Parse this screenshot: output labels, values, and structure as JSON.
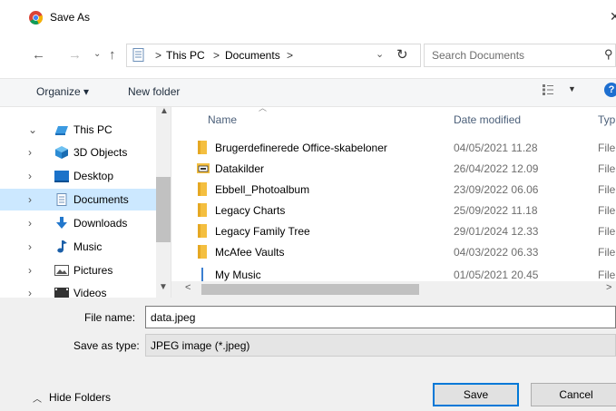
{
  "window": {
    "title": "Save As",
    "close_glyph": "✕"
  },
  "address": {
    "segments": [
      "This PC",
      "Documents"
    ],
    "separator": ">",
    "search_placeholder": "Search Documents"
  },
  "toolbar": {
    "organize": "Organize ▾",
    "new_folder": "New folder"
  },
  "nav": {
    "items": [
      {
        "label": "This PC",
        "icon": "pc-icon",
        "chevron": "⌄",
        "selected": false
      },
      {
        "label": "3D Objects",
        "icon": "cube-icon",
        "chevron": "›",
        "selected": false
      },
      {
        "label": "Desktop",
        "icon": "desktop-icon",
        "chevron": "›",
        "selected": false
      },
      {
        "label": "Documents",
        "icon": "documents-icon",
        "chevron": "›",
        "selected": true
      },
      {
        "label": "Downloads",
        "icon": "download-icon",
        "chevron": "›",
        "selected": false
      },
      {
        "label": "Music",
        "icon": "music-icon",
        "chevron": "›",
        "selected": false
      },
      {
        "label": "Pictures",
        "icon": "pictures-icon",
        "chevron": "›",
        "selected": false
      },
      {
        "label": "Videos",
        "icon": "videos-icon",
        "chevron": "›",
        "selected": false
      }
    ]
  },
  "files": {
    "columns": {
      "name": "Name",
      "date": "Date modified",
      "type": "Typ"
    },
    "rows": [
      {
        "name": "Brugerdefinerede Office-skabeloner",
        "date": "04/05/2021 11.28",
        "type": "File",
        "icon": "folder-icon"
      },
      {
        "name": "Datakilder",
        "date": "26/04/2022 12.09",
        "type": "File",
        "icon": "datasource-folder-icon"
      },
      {
        "name": "Ebbell_Photoalbum",
        "date": "23/09/2022 06.06",
        "type": "File",
        "icon": "folder-icon"
      },
      {
        "name": "Legacy Charts",
        "date": "25/09/2022 11.18",
        "type": "File",
        "icon": "folder-icon"
      },
      {
        "name": "Legacy Family Tree",
        "date": "29/01/2024 12.33",
        "type": "File",
        "icon": "folder-icon"
      },
      {
        "name": "McAfee Vaults",
        "date": "04/03/2022 06.33",
        "type": "File",
        "icon": "folder-icon"
      },
      {
        "name": "My Music",
        "date": "01/05/2021 20.45",
        "type": "File",
        "icon": "music-folder-icon"
      }
    ]
  },
  "form": {
    "file_name_label": "File name:",
    "file_name_value": "data.jpeg",
    "save_as_type_label": "Save as type:",
    "save_as_type_value": "JPEG image (*.jpeg)"
  },
  "footer": {
    "hide_folders": "Hide Folders",
    "save": "Save",
    "cancel": "Cancel"
  },
  "colors": {
    "accent": "#0078d7",
    "selection": "#cce8ff",
    "folder": "#f4bf40"
  }
}
